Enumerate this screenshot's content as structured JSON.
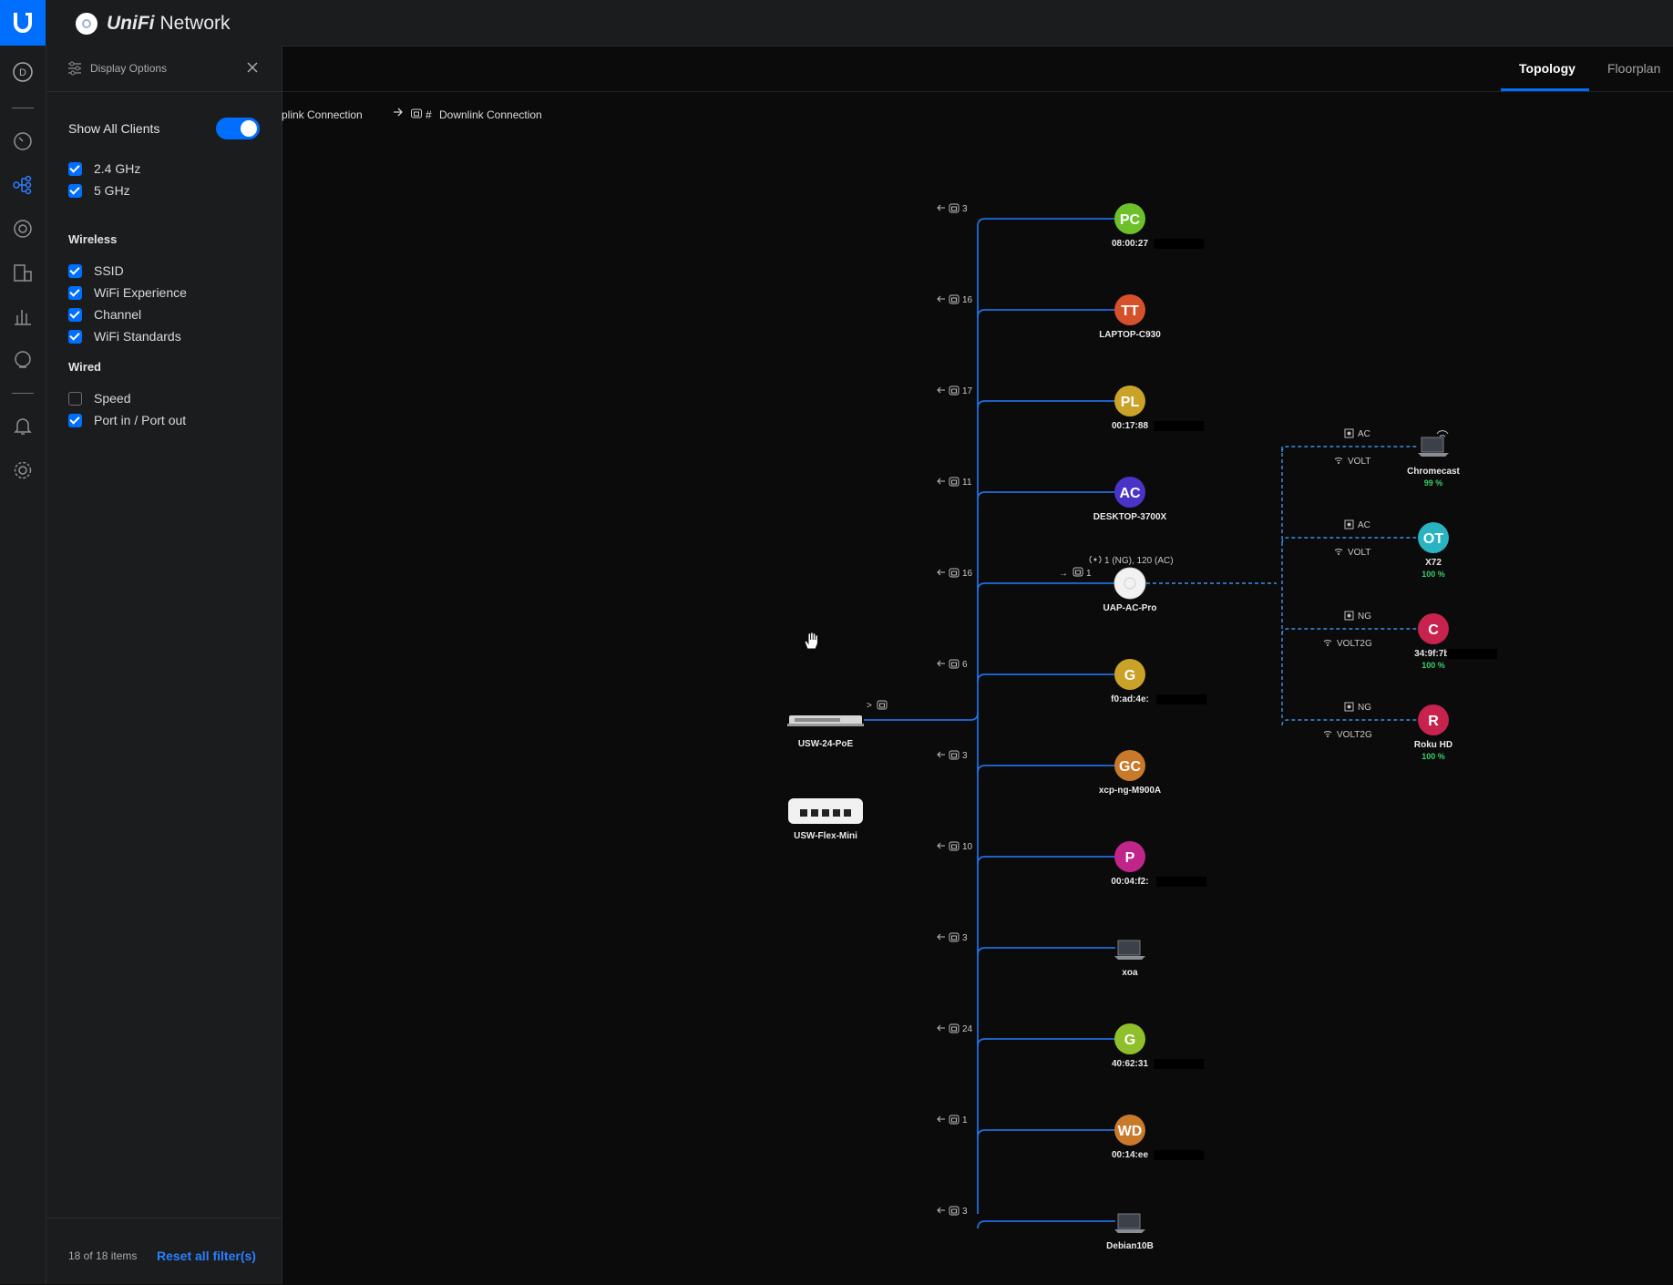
{
  "header": {
    "brand": "UniFi",
    "product": "Network"
  },
  "rail": {
    "items": [
      {
        "name": "dashboard-icon",
        "glyph": "D"
      },
      {
        "name": "sidebar-separator"
      },
      {
        "name": "speedometer-icon"
      },
      {
        "name": "topology-icon",
        "active": true
      },
      {
        "name": "devices-icon"
      },
      {
        "name": "clients-icon"
      },
      {
        "name": "statistics-icon"
      },
      {
        "name": "insights-icon"
      },
      {
        "name": "sidebar-separator"
      },
      {
        "name": "bell-icon"
      },
      {
        "name": "gear-icon"
      }
    ]
  },
  "panel": {
    "title": "Display Options",
    "show_all_clients": "Show All Clients",
    "show_all_clients_on": true,
    "bands": [
      {
        "label": "2.4 GHz",
        "checked": true
      },
      {
        "label": "5 GHz",
        "checked": true
      }
    ],
    "wireless_title": "Wireless",
    "wireless": [
      {
        "label": "SSID",
        "checked": true
      },
      {
        "label": "WiFi Experience",
        "checked": true
      },
      {
        "label": "Channel",
        "checked": true
      },
      {
        "label": "WiFi Standards",
        "checked": true
      }
    ],
    "wired_title": "Wired",
    "wired": [
      {
        "label": "Speed",
        "checked": false
      },
      {
        "label": "Port in / Port out",
        "checked": true
      }
    ],
    "footer_count": "18 of 18 items",
    "footer_reset": "Reset all filter(s)"
  },
  "tabs": [
    {
      "label": "Topology",
      "active": true
    },
    {
      "label": "Floorplan",
      "active": false
    }
  ],
  "legend": {
    "uplink": "plink Connection",
    "downlink_symbol": "#",
    "downlink": "Downlink Connection"
  },
  "colors": {
    "accent": "#006fff",
    "wire": "#1f6fe0",
    "wireless": "#3d8fe6",
    "signal": "#36d06a"
  },
  "topology": {
    "switches": [
      {
        "name": "USW-24-PoE",
        "uplink_symbol": ">"
      },
      {
        "name": "USW-Flex-Mini"
      }
    ],
    "wired_clients": [
      {
        "port": "3",
        "initials": "PC",
        "label": "08:00:27",
        "color": "#6cc12b",
        "redacted": true
      },
      {
        "port": "16",
        "initials": "TT",
        "label": "LAPTOP-C930",
        "color": "#d5512b",
        "redacted": false
      },
      {
        "port": "17",
        "initials": "PL",
        "label": "00:17:88",
        "color": "#c9a227",
        "redacted": true
      },
      {
        "port": "11",
        "initials": "AC",
        "label": "DESKTOP-3700X",
        "color": "#4a34c7",
        "redacted": false
      },
      {
        "port": "16",
        "initials": "",
        "label": "UAP-AC-Pro",
        "color": "#ffffff",
        "redacted": false,
        "is_ap": true
      },
      {
        "port": "6",
        "initials": "G",
        "label": "f0:ad:4e:",
        "color": "#c9a227",
        "redacted": true
      },
      {
        "port": "3",
        "initials": "GC",
        "label": "xcp-ng-M900A",
        "color": "#c8792a",
        "redacted": false
      },
      {
        "port": "10",
        "initials": "P",
        "label": "00:04:f2:",
        "color": "#c0268a",
        "redacted": true
      },
      {
        "port": "3",
        "initials": "",
        "label": "xoa",
        "color": "",
        "redacted": false,
        "is_device": true
      },
      {
        "port": "24",
        "initials": "G",
        "label": "40:62:31",
        "color": "#8fbf2a",
        "redacted": true
      },
      {
        "port": "1",
        "initials": "WD",
        "label": "00:14:ee",
        "color": "#c8792a",
        "redacted": true
      },
      {
        "port": "3",
        "initials": "",
        "label": "Debian10B",
        "color": "",
        "redacted": false,
        "is_device": true
      }
    ],
    "ap": {
      "channels": "1 (NG), 120 (AC)",
      "uplink_symbol": "→",
      "uplink_port": "1"
    },
    "wireless_clients": [
      {
        "standard": "AC",
        "ssid": "VOLT",
        "initials": "",
        "label": "Chromecast",
        "signal": "99 %",
        "color": "",
        "is_device": true,
        "redacted": false
      },
      {
        "standard": "AC",
        "ssid": "VOLT",
        "initials": "OT",
        "label": "X72",
        "signal": "100 %",
        "color": "#2ab3c0",
        "redacted": false
      },
      {
        "standard": "NG",
        "ssid": "VOLT2G",
        "initials": "C",
        "label": "34:9f:7b:",
        "signal": "100 %",
        "color": "#c8234e",
        "redacted": true
      },
      {
        "standard": "NG",
        "ssid": "VOLT2G",
        "initials": "R",
        "label": "Roku HD",
        "signal": "100 %",
        "color": "#c8234e",
        "redacted": false
      }
    ]
  }
}
